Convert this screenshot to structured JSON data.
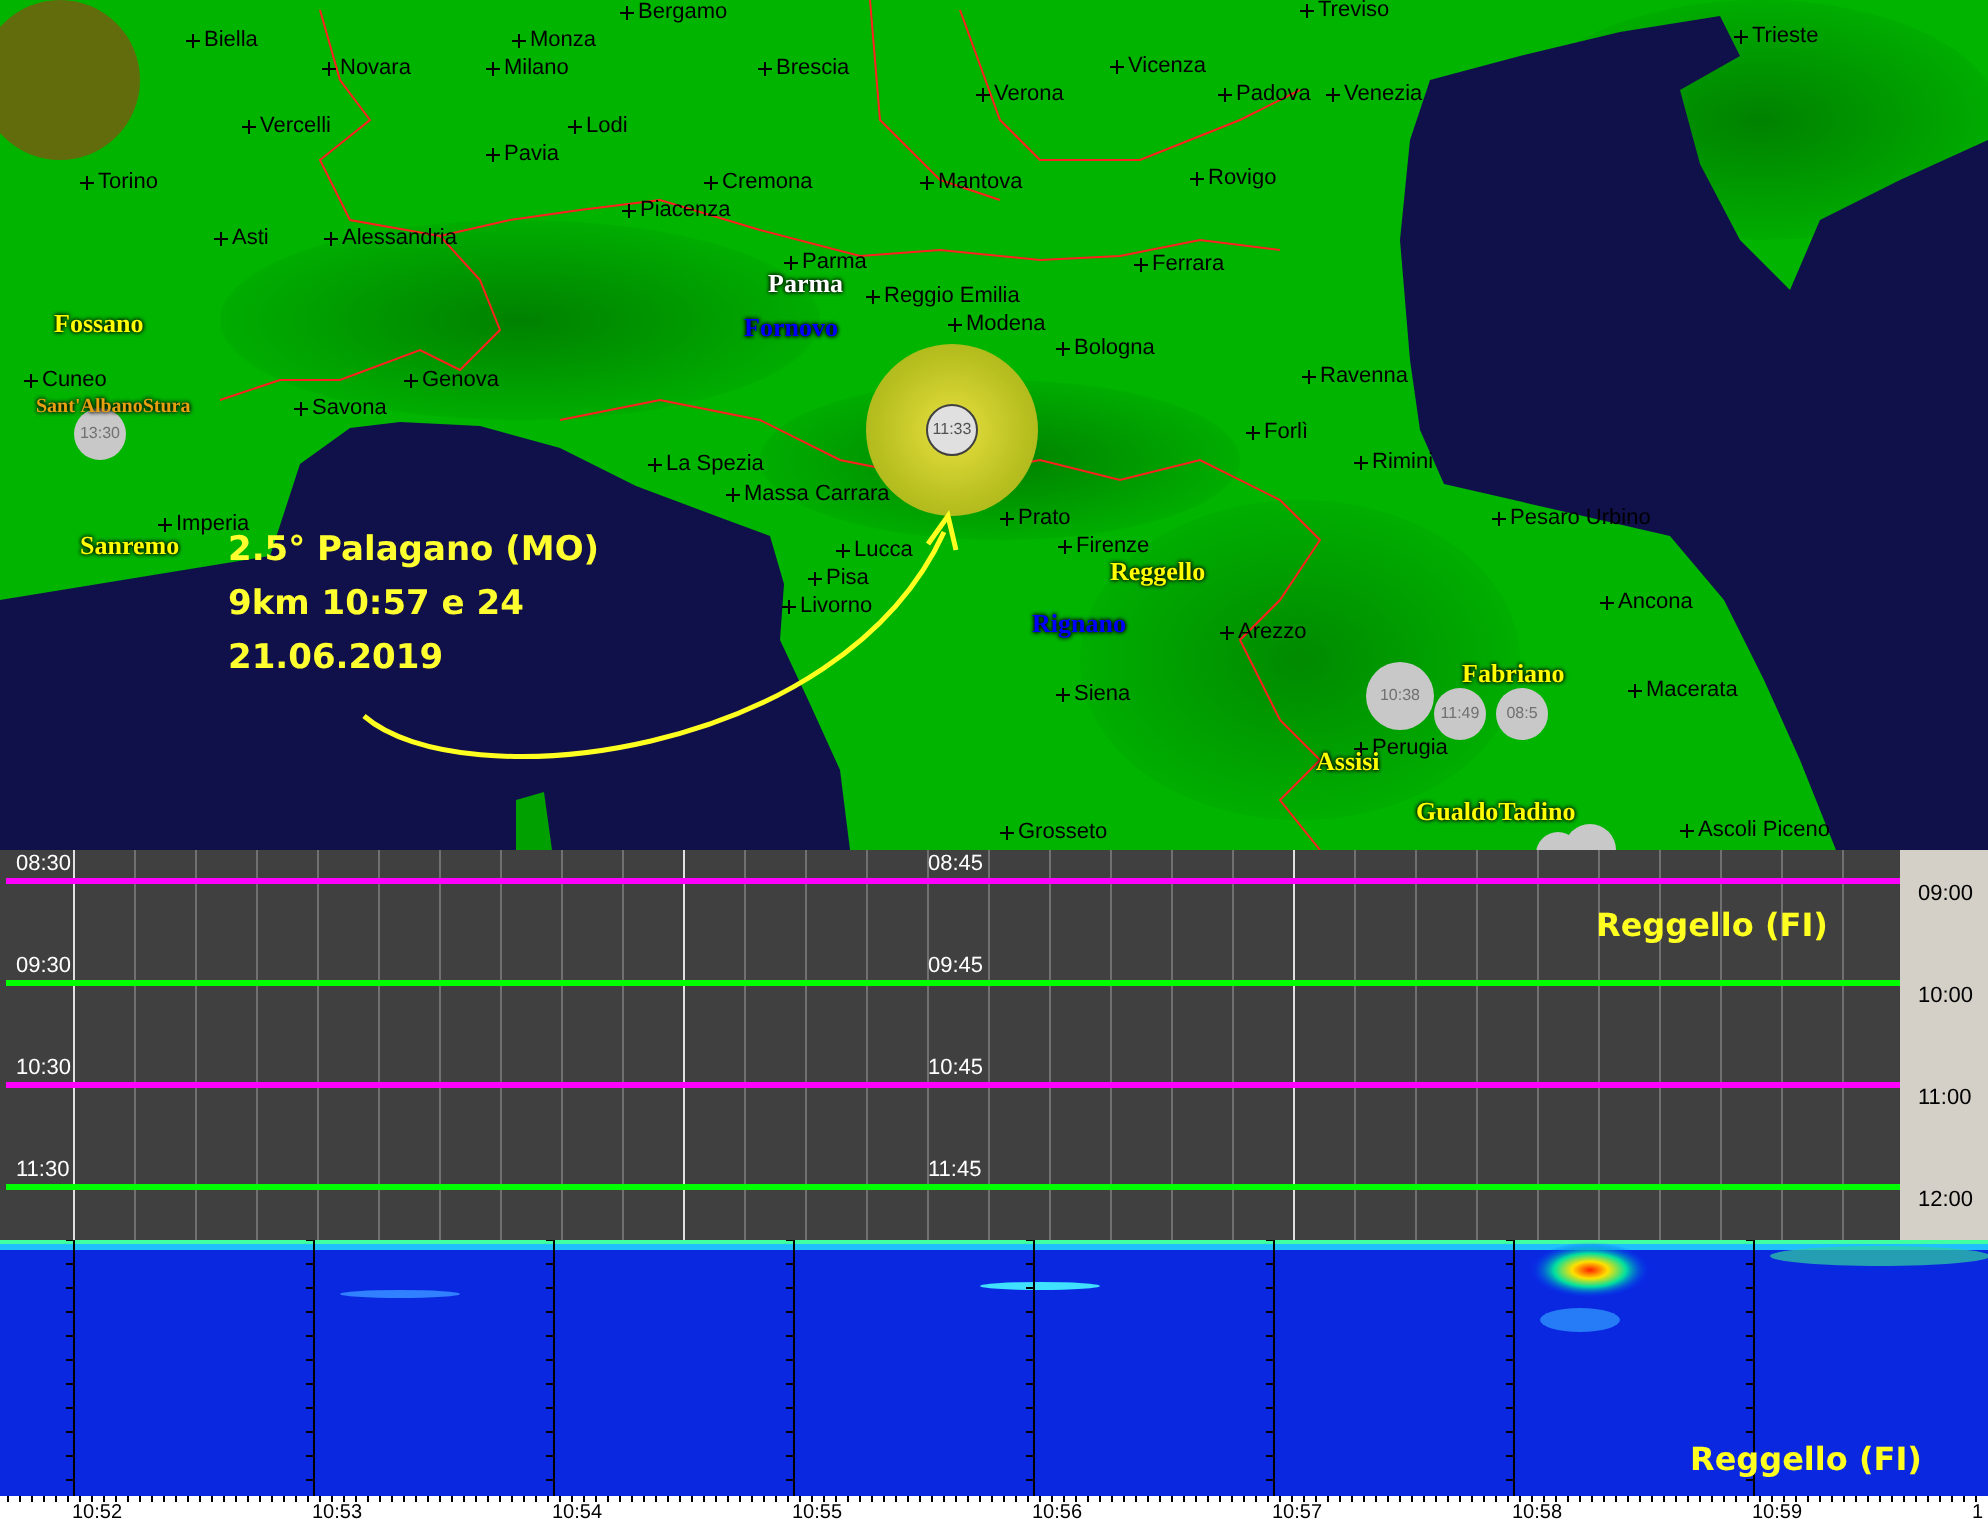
{
  "map": {
    "cities": [
      "Bergamo",
      "Treviso",
      "Biella",
      "Monza",
      "Trieste",
      "Novara",
      "Milano",
      "Brescia",
      "Vicenza",
      "Verona",
      "Padova",
      "Venezia",
      "Vercelli",
      "Lodi",
      "Pavia",
      "Torino",
      "Cremona",
      "Mantova",
      "Rovigo",
      "Piacenza",
      "Asti",
      "Alessandria",
      "Parma",
      "Ferrara",
      "Reggio Emilia",
      "Modena",
      "Bologna",
      "Cuneo",
      "Genova",
      "Ravenna",
      "Savona",
      "Forlì",
      "La Spezia",
      "Rimini",
      "Massa Carrara",
      "Imperia",
      "Prato",
      "Pesaro Urbino",
      "Lucca",
      "Firenze",
      "Pisa",
      "Livorno",
      "Ancona",
      "Arezzo",
      "Siena",
      "Macerata",
      "Perugia",
      "Grosseto",
      "Ascoli Piceno"
    ],
    "stations": [
      {
        "name": "Fossano",
        "color": "#ffff00"
      },
      {
        "name": "Sant'AlbanoStura",
        "color": "#e8a010"
      },
      {
        "name": "Parma",
        "color": "#ffffff"
      },
      {
        "name": "Fornovo",
        "color": "#0000ff"
      },
      {
        "name": "Sanremo",
        "color": "#ffff00"
      },
      {
        "name": "Reggello",
        "color": "#ffff00"
      },
      {
        "name": "Rignano",
        "color": "#0000ff"
      },
      {
        "name": "Fabriano",
        "color": "#ffff00"
      },
      {
        "name": "Assisi",
        "color": "#ffff00"
      },
      {
        "name": "GualdoTadino",
        "color": "#ffff00"
      }
    ],
    "events": [
      {
        "time": "13:30"
      },
      {
        "time": "10:38"
      },
      {
        "time": "11:49"
      },
      {
        "time": "08:5"
      }
    ],
    "highlight_event": {
      "time": "11:33"
    },
    "annotation": [
      "2.5° Palagano (MO)",
      "9km 10:57 e 24",
      "21.06.2019"
    ]
  },
  "helicorder": {
    "station": "Reggello (FI)",
    "rows": [
      {
        "left_time": "08:30",
        "mid_time": "08:45",
        "right_time": "09:00",
        "color": "#ff00ff"
      },
      {
        "left_time": "09:30",
        "mid_time": "09:45",
        "right_time": "10:00",
        "color": "#00ff00"
      },
      {
        "left_time": "10:30",
        "mid_time": "10:45",
        "right_time": "11:00",
        "color": "#ff00ff"
      },
      {
        "left_time": "11:30",
        "mid_time": "11:45",
        "right_time": "12:00",
        "color": "#00ff00"
      }
    ]
  },
  "spectrogram": {
    "station": "Reggello (FI)",
    "time_labels": [
      "10:52",
      "10:53",
      "10:54",
      "10:55",
      "10:56",
      "10:57",
      "10:58",
      "10:59",
      "1"
    ]
  }
}
